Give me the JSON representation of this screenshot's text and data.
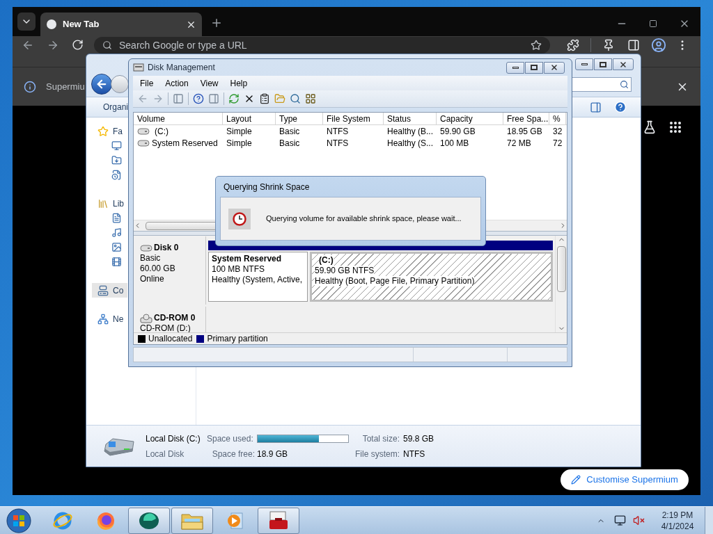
{
  "browser": {
    "tab_title": "New Tab",
    "omnibox_placeholder": "Search Google or type a URL",
    "infobar_text": "Supermiu",
    "customise_button": "Customise Supermium"
  },
  "explorer": {
    "organize": "Organi",
    "nav": [
      {
        "label": "Fa",
        "kind": "favorites",
        "selected": false
      },
      {
        "label": "Lib",
        "kind": "libraries",
        "selected": false
      },
      {
        "label": "Co",
        "kind": "computer",
        "selected": true
      },
      {
        "label": "Ne",
        "kind": "network",
        "selected": false
      }
    ],
    "details": {
      "name": "Local Disk (C:)",
      "type": "Local Disk",
      "used_label": "Space used:",
      "level": 0.68,
      "total_label": "Total size:",
      "total": "59.8 GB",
      "free_label": "Space free:",
      "free": "18.9 GB",
      "fs_label": "File system:",
      "fs": "NTFS"
    }
  },
  "disk_management": {
    "title": "Disk Management",
    "menu": [
      "File",
      "Action",
      "View",
      "Help"
    ],
    "columns": [
      "Volume",
      "Layout",
      "Type",
      "File System",
      "Status",
      "Capacity",
      "Free Spa...",
      "%"
    ],
    "rows": [
      {
        "cells": [
          "(C:)",
          "Simple",
          "Basic",
          "NTFS",
          "Healthy (B...",
          "59.90 GB",
          "18.95 GB",
          "32"
        ]
      },
      {
        "cells": [
          "System Reserved",
          "Simple",
          "Basic",
          "NTFS",
          "Healthy (S...",
          "100 MB",
          "72 MB",
          "72"
        ]
      }
    ],
    "disks": [
      {
        "kind": "disk",
        "name": "Disk 0",
        "lines": [
          "Basic",
          "60.00 GB",
          "Online"
        ],
        "partitions": [
          {
            "name": "System Reserved",
            "size": "100 MB NTFS",
            "status": "Healthy (System, Active,",
            "selected": false
          },
          {
            "name": "(C:)",
            "size": "59.90 GB NTFS",
            "status": "Healthy (Boot, Page File, Primary Partition)",
            "selected": true
          }
        ]
      },
      {
        "kind": "cdrom",
        "name": "CD-ROM 0",
        "lines": [
          "CD-ROM (D:)"
        ]
      }
    ],
    "legend": [
      {
        "label": "Unallocated",
        "color": "#000000"
      },
      {
        "label": "Primary partition",
        "color": "#000080"
      }
    ]
  },
  "dialog": {
    "title": "Querying Shrink Space",
    "message": "Querying volume for available shrink space, please wait..."
  },
  "taskbar": {
    "items": [
      {
        "kind": "ie",
        "running": false
      },
      {
        "kind": "firefox",
        "running": false
      },
      {
        "kind": "app",
        "running": true
      },
      {
        "kind": "explorer",
        "running": true
      },
      {
        "kind": "media",
        "running": false
      },
      {
        "kind": "toolbox",
        "running": true
      }
    ],
    "time": "2:19 PM",
    "date": "4/1/2024"
  }
}
